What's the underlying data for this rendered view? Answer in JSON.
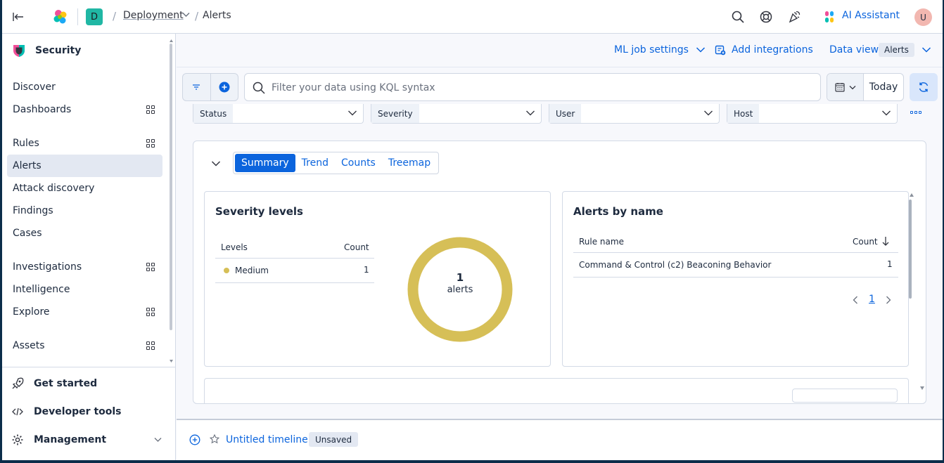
{
  "header": {
    "space_initial": "D",
    "breadcrumbs": [
      "Deployment",
      "Alerts"
    ],
    "ai_assistant_label": "AI Assistant",
    "user_initial": "U"
  },
  "sidebar": {
    "title": "Security",
    "items": [
      {
        "label": "Discover",
        "grid": false
      },
      {
        "label": "Dashboards",
        "grid": true
      },
      {
        "label": "Rules",
        "grid": true
      },
      {
        "label": "Alerts",
        "grid": false,
        "active": true
      },
      {
        "label": "Attack discovery",
        "grid": false
      },
      {
        "label": "Findings",
        "grid": false
      },
      {
        "label": "Cases",
        "grid": false
      },
      {
        "label": "Investigations",
        "grid": true
      },
      {
        "label": "Intelligence",
        "grid": false
      },
      {
        "label": "Explore",
        "grid": true
      },
      {
        "label": "Assets",
        "grid": true
      }
    ],
    "footer": {
      "get_started": "Get started",
      "developer_tools": "Developer tools",
      "management": "Management"
    }
  },
  "subheader": {
    "ml_job_settings": "ML job settings",
    "add_integrations": "Add integrations",
    "data_view_label": "Data view",
    "data_view_value": "Alerts"
  },
  "search": {
    "placeholder": "Filter your data using KQL syntax",
    "date_label": "Today"
  },
  "controls": [
    "Status",
    "Severity",
    "User",
    "Host"
  ],
  "tabs": [
    {
      "label": "Summary",
      "active": true
    },
    {
      "label": "Trend",
      "active": false
    },
    {
      "label": "Counts",
      "active": false
    },
    {
      "label": "Treemap",
      "active": false
    }
  ],
  "severity_card": {
    "title": "Severity levels",
    "col_levels": "Levels",
    "col_count": "Count",
    "rows": [
      {
        "level": "Medium",
        "count": "1",
        "color": "#d6bf57"
      }
    ],
    "donut_total": "1",
    "donut_label": "alerts",
    "donut_color": "#d6bf57"
  },
  "alerts_card": {
    "title": "Alerts by name",
    "col_rule": "Rule name",
    "col_count": "Count",
    "rows": [
      {
        "rule": "Command & Control (c2) Beaconing Behavior",
        "count": "1"
      }
    ],
    "page": "1"
  },
  "timeline": {
    "title": "Untitled timeline",
    "badge": "Unsaved"
  },
  "colors": {
    "accent": "#0b64dd",
    "medium_severity": "#d6bf57",
    "active_nav": "#e3e8f2"
  }
}
